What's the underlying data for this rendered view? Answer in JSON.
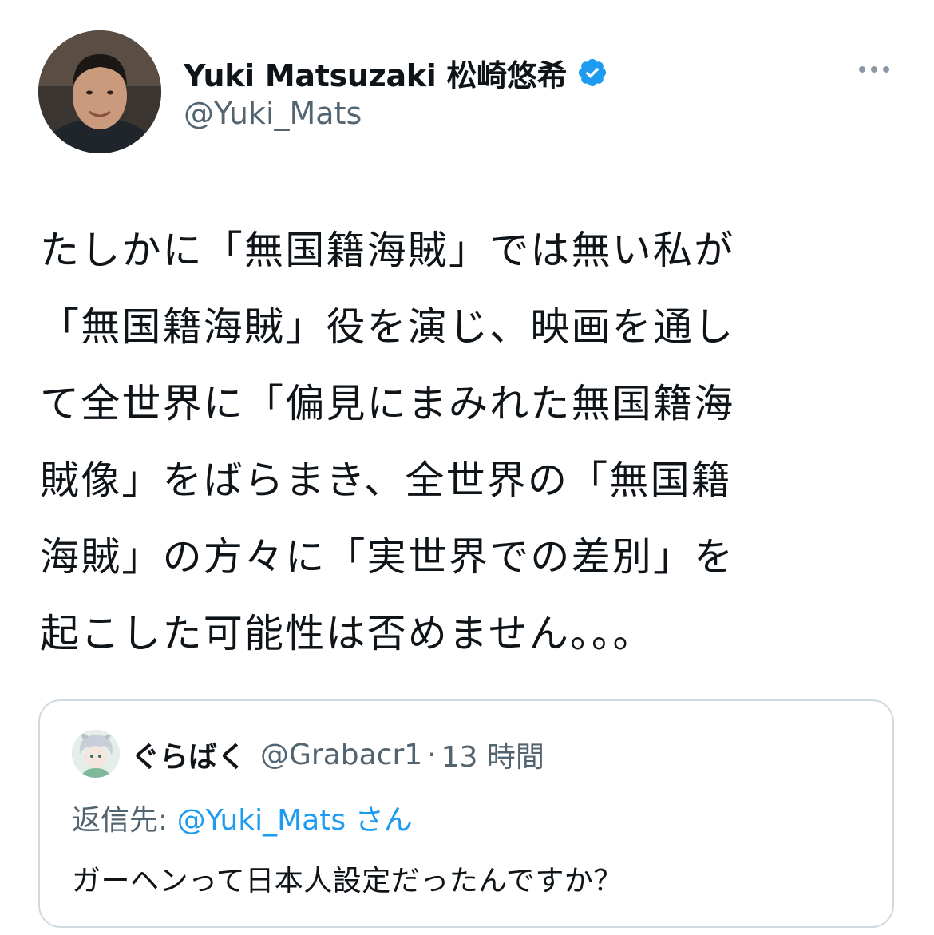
{
  "tweet": {
    "author": {
      "display_name": "Yuki Matsuzaki 松崎悠希",
      "handle": "@Yuki_Mats",
      "verified": true,
      "avatar_icon": "profile-photo"
    },
    "more_icon": "more-horizontal-icon",
    "text_lines": [
      "たしかに「無国籍海賊」では無い私が",
      "「無国籍海賊」役を演じ、映画を通し",
      "て全世界に「偏見にまみれた無国籍海",
      "賊像」をばらまき、全世界の「無国籍",
      "海賊」の方々に「実世界での差別」を",
      "起こした可能性は否めません。。。"
    ]
  },
  "quoted_tweet": {
    "display_name": "ぐらばく",
    "handle": "@Grabacr1",
    "separator": "·",
    "time": "13 時間",
    "reply_label": "返信先:",
    "reply_mention": "@Yuki_Mats",
    "reply_suffix": "さん",
    "text": "ガーヘンって日本人設定だったんですか？"
  },
  "colors": {
    "text": "#0f1419",
    "secondary": "#536471",
    "accent": "#1d9bf0",
    "border": "#cfd9de"
  }
}
